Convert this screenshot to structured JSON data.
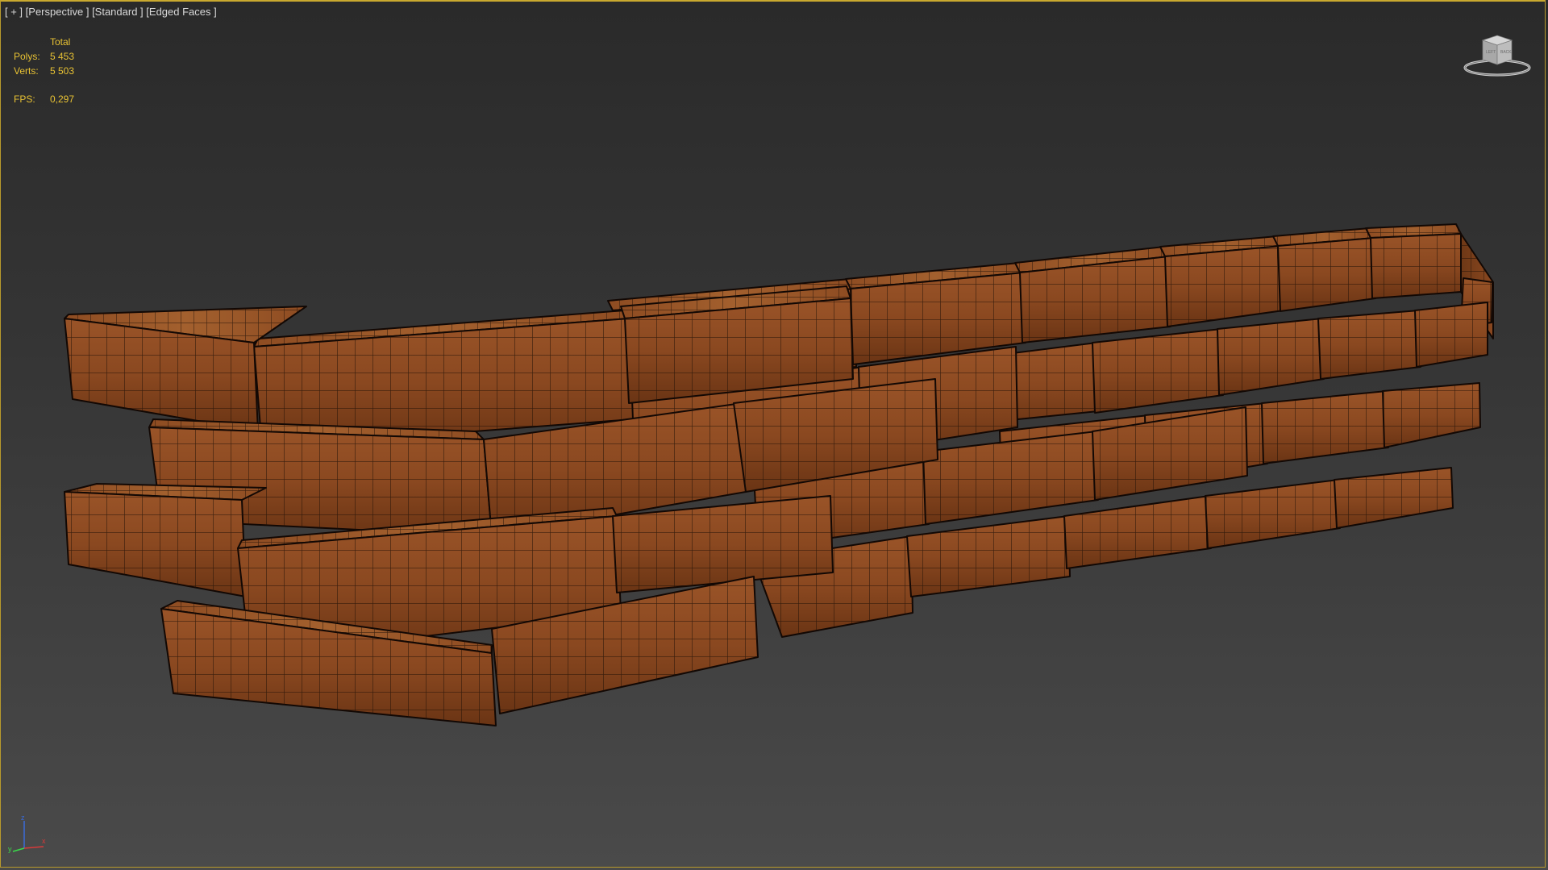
{
  "viewport": {
    "plus": "[ + ]",
    "view": "[Perspective ]",
    "shading": "[Standard ]",
    "edged": "[Edged Faces ]"
  },
  "stats": {
    "header": "Total",
    "polys_label": "Polys:",
    "polys_value": "5 453",
    "verts_label": "Verts:",
    "verts_value": "5 503",
    "fps_label": "FPS:",
    "fps_value": "0,297"
  },
  "viewcube": {
    "left_face": "LEFT",
    "front_face": "BACK",
    "icon": "viewcube-icon"
  },
  "axis": {
    "z_label": "z",
    "x_label": "x",
    "y_label": "y"
  },
  "colors": {
    "border_active": "#c9a92f",
    "stats_text": "#e8c233",
    "brick": "#8a4a22",
    "brick_light": "#a85d2e",
    "brick_dark": "#5a2c12",
    "edge": "#1a0e08"
  }
}
